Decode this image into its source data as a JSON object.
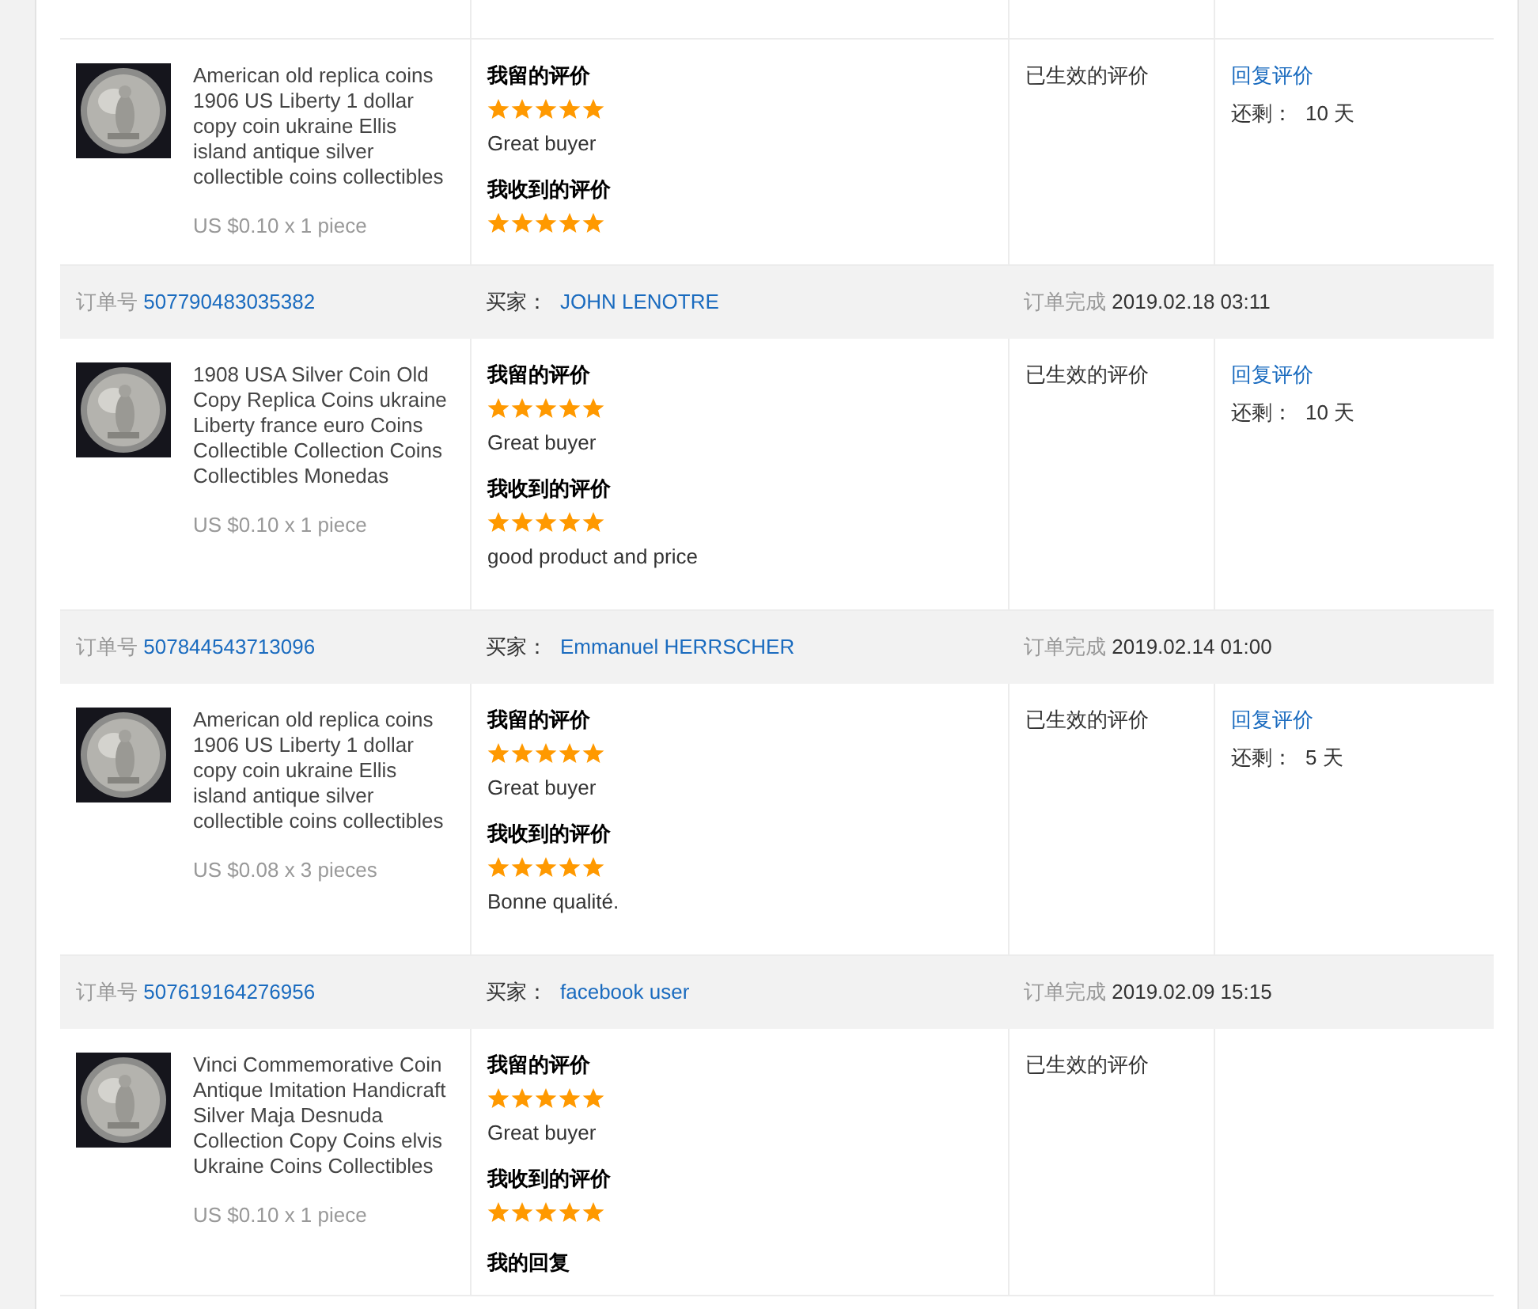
{
  "orders": [
    {
      "product": {
        "title": "American old replica coins 1906 US Liberty 1 dollar copy coin ukraine Ellis island antique silver collectible coins collectibles",
        "price": "US $0.10 x 1 piece"
      },
      "reviews": [
        {
          "heading": "我留的评价",
          "stars": 5,
          "text": "Great buyer"
        },
        {
          "heading": "我收到的评价",
          "stars": 5
        }
      ],
      "status": "已生效的评价",
      "action": {
        "link": "回复评价",
        "remaining_label": "还剩：",
        "remaining": "10 天"
      }
    },
    {
      "header": {
        "order_label": "订单号",
        "order_no": "507790483035382",
        "buyer_label": "买家：",
        "buyer": "JOHN LENOTRE",
        "completed_label": "订单完成",
        "completed_time": "2019.02.18 03:11"
      },
      "product": {
        "title": "1908 USA Silver Coin Old Copy Replica Coins ukraine Liberty france euro Coins Collectible Collection Coins Collectibles Monedas",
        "price": "US $0.10 x 1 piece"
      },
      "reviews": [
        {
          "heading": "我留的评价",
          "stars": 5,
          "text": "Great buyer"
        },
        {
          "heading": "我收到的评价",
          "stars": 5,
          "text": "good product and price"
        }
      ],
      "status": "已生效的评价",
      "action": {
        "link": "回复评价",
        "remaining_label": "还剩：",
        "remaining": "10 天"
      }
    },
    {
      "header": {
        "order_label": "订单号",
        "order_no": "507844543713096",
        "buyer_label": "买家：",
        "buyer": "Emmanuel HERRSCHER",
        "completed_label": "订单完成",
        "completed_time": "2019.02.14 01:00"
      },
      "product": {
        "title": "American old replica coins 1906 US Liberty 1 dollar copy coin ukraine Ellis island antique silver collectible coins collectibles",
        "price": "US $0.08 x 3 pieces"
      },
      "reviews": [
        {
          "heading": "我留的评价",
          "stars": 5,
          "text": "Great buyer"
        },
        {
          "heading": "我收到的评价",
          "stars": 5,
          "text": "Bonne qualité."
        }
      ],
      "status": "已生效的评价",
      "action": {
        "link": "回复评价",
        "remaining_label": "还剩：",
        "remaining": "5 天"
      }
    },
    {
      "header": {
        "order_label": "订单号",
        "order_no": "507619164276956",
        "buyer_label": "买家：",
        "buyer": "facebook user",
        "completed_label": "订单完成",
        "completed_time": "2019.02.09 15:15"
      },
      "product": {
        "title": "Vinci Commemorative Coin Antique Imitation Handicraft Silver Maja Desnuda Collection Copy Coins elvis Ukraine Coins Collectibles",
        "price": "US $0.10 x 1 piece"
      },
      "reviews": [
        {
          "heading": "我留的评价",
          "stars": 5,
          "text": "Great buyer"
        },
        {
          "heading": "我收到的评价",
          "stars": 5
        },
        {
          "heading": "我的回复"
        }
      ],
      "status": "已生效的评价"
    }
  ]
}
